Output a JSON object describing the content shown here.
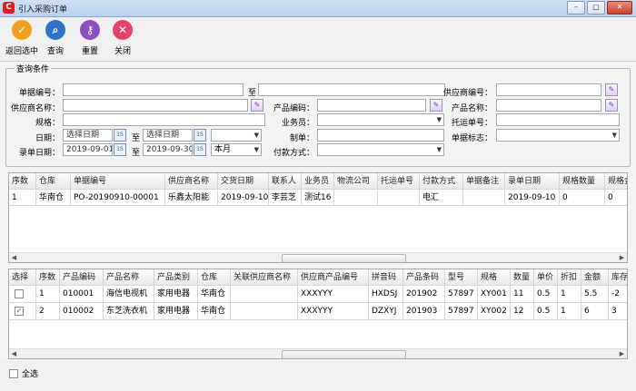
{
  "window": {
    "title": "引入采购订单",
    "app_icon": "app-logo-icon"
  },
  "toolbar": {
    "buttons": [
      {
        "label": "返回选中",
        "icon": "check-icon",
        "color": "#f0a020"
      },
      {
        "label": "查询",
        "icon": "search-icon",
        "color": "#2f73c9"
      },
      {
        "label": "重置",
        "icon": "key-icon",
        "color": "#8c4fc0"
      },
      {
        "label": "关闭",
        "icon": "close-icon",
        "color": "#e0446b"
      }
    ]
  },
  "query": {
    "legend": "查询条件",
    "order_no_label": "单据编号：",
    "to_label": "至",
    "supplier_no_label": "供应商编号：",
    "supplier_name_label": "供应商名称：",
    "product_code_label": "产品编码：",
    "product_name_label": "产品名称：",
    "spec_label": "规格：",
    "salesman_label": "业务员：",
    "tracking_label": "托运单号：",
    "date_label": "日期：",
    "maker_label": "制单：",
    "doc_flag_label": "单据标志：",
    "entry_date_label": "录单日期：",
    "payment_label": "付款方式：",
    "date_placeholder_from": "选择日期",
    "date_placeholder_to": "选择日期",
    "entry_date_from": "2019-09-01",
    "entry_date_to": "2019-09-30",
    "entry_period": "本月",
    "cal_icon_text": "15"
  },
  "orders": {
    "columns": [
      "序数",
      "仓库",
      "单据编号",
      "供应商名称",
      "交货日期",
      "联系人",
      "业务员",
      "物流公司",
      "托运单号",
      "付款方式",
      "单据备注",
      "录单日期",
      "规格数量",
      "规格金"
    ],
    "rows": [
      [
        "1",
        "华南仓",
        "PO-20190910-00001",
        "乐鑫太阳能",
        "2019-09-10",
        "李芸芝",
        "测试16",
        "",
        "",
        "电汇",
        "",
        "2019-09-10",
        "0",
        "0"
      ]
    ]
  },
  "items": {
    "columns": [
      "选择",
      "序数",
      "产品编码",
      "产品名称",
      "产品类别",
      "仓库",
      "关联供应商名称",
      "供应商产品编号",
      "拼音码",
      "产品条码",
      "型号",
      "规格",
      "数量",
      "单价",
      "折扣",
      "金额",
      "库存数"
    ],
    "rows": [
      {
        "checked": false,
        "cells": [
          "",
          "1",
          "010001",
          "海信电视机",
          "家用电器",
          "华南仓",
          "",
          "XXXYYY",
          "HXDSJ",
          "201902",
          "57897",
          "XY001",
          "11",
          "0.5",
          "1",
          "5.5",
          "-2"
        ]
      },
      {
        "checked": true,
        "cells": [
          "",
          "2",
          "010002",
          "东芝洗衣机",
          "家用电器",
          "华南仓",
          "",
          "XXXYYY",
          "DZXYJ",
          "201903",
          "57897",
          "XY002",
          "12",
          "0.5",
          "1",
          "6",
          "3"
        ]
      }
    ]
  },
  "footer": {
    "select_all_label": "全选"
  }
}
